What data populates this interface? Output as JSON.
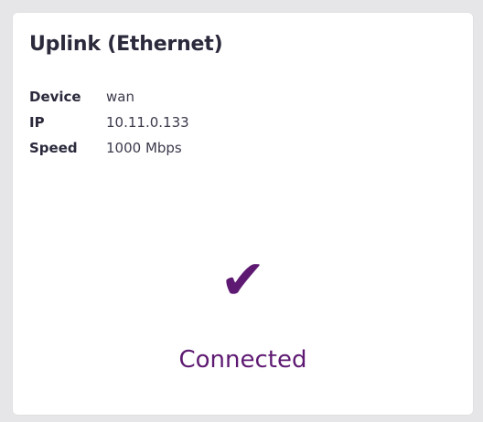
{
  "card": {
    "title": "Uplink (Ethernet)",
    "rows": [
      {
        "key": "Device",
        "value": "wan"
      },
      {
        "key": "IP",
        "value": "10.11.0.133"
      },
      {
        "key": "Speed",
        "value": "1000 Mbps"
      }
    ],
    "status_icon": "checkmark-icon",
    "status": "Connected",
    "accent_color": "#5e1a72"
  }
}
